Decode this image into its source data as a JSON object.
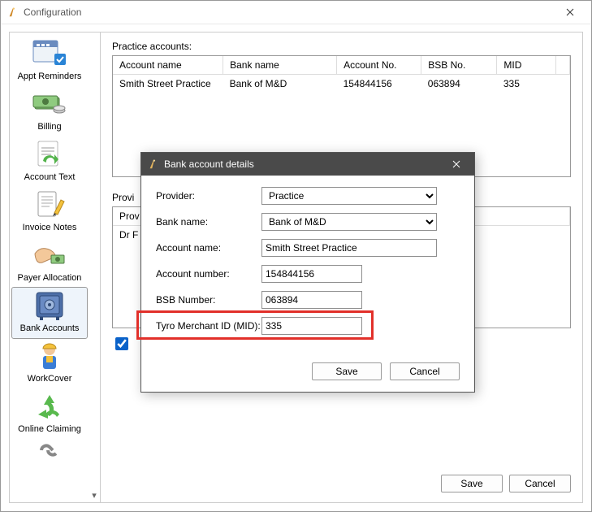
{
  "window": {
    "title": "Configuration",
    "save_label": "Save",
    "cancel_label": "Cancel"
  },
  "sidebar": {
    "items": [
      {
        "label": "Appt Reminders"
      },
      {
        "label": "Billing"
      },
      {
        "label": "Account Text"
      },
      {
        "label": "Invoice Notes"
      },
      {
        "label": "Payer Allocation"
      },
      {
        "label": "Bank Accounts"
      },
      {
        "label": "WorkCover"
      },
      {
        "label": "Online Claiming"
      }
    ]
  },
  "practice_accounts": {
    "heading": "Practice accounts:",
    "columns": {
      "account_name": "Account name",
      "bank_name": "Bank name",
      "account_no": "Account No.",
      "bsb_no": "BSB No.",
      "mid": "MID"
    },
    "rows": [
      {
        "account_name": "Smith Street Practice",
        "bank_name": "Bank of M&D",
        "account_no": "154844156",
        "bsb_no": "063894",
        "mid": "335"
      }
    ]
  },
  "provider_accounts": {
    "heading": "Provi",
    "columns": {
      "provider": "Prov"
    },
    "rows": [
      {
        "provider": "Dr F"
      }
    ]
  },
  "dialog": {
    "title": "Bank account details",
    "labels": {
      "provider": "Provider:",
      "bank_name": "Bank name:",
      "account_name": "Account name:",
      "account_number": "Account number:",
      "bsb_number": "BSB Number:",
      "tyro_mid": "Tyro Merchant ID (MID):"
    },
    "values": {
      "provider": "Practice",
      "bank_name": "Bank of M&D",
      "account_name": "Smith Street Practice",
      "account_number": "154844156",
      "bsb_number": "063894",
      "tyro_mid": "335"
    },
    "save_label": "Save",
    "cancel_label": "Cancel"
  }
}
